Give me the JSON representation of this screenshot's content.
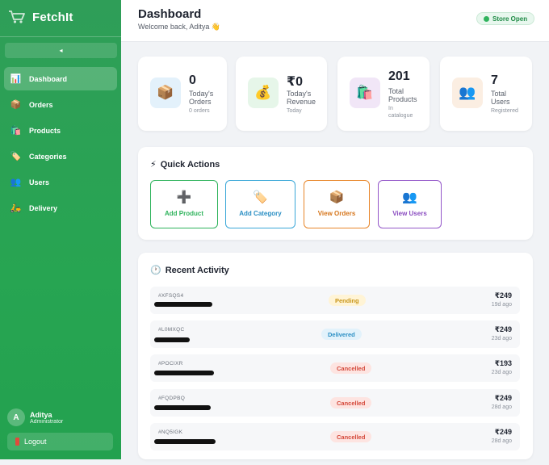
{
  "sidebar": {
    "brand": "FetchIt",
    "collapse_glyph": "◂",
    "items": [
      {
        "label": "Dashboard",
        "icon": "chart-icon",
        "glyph": "📊",
        "active": true
      },
      {
        "label": "Orders",
        "icon": "box-icon",
        "glyph": "📦",
        "active": false
      },
      {
        "label": "Products",
        "icon": "shopping-bags-icon",
        "glyph": "🛍️",
        "active": false
      },
      {
        "label": "Categories",
        "icon": "tag-icon",
        "glyph": "🏷️",
        "active": false
      },
      {
        "label": "Users",
        "icon": "users-icon",
        "glyph": "👥",
        "active": false
      },
      {
        "label": "Delivery",
        "icon": "scooter-icon",
        "glyph": "🛵",
        "active": false
      }
    ],
    "user": {
      "initial": "A",
      "name": "Aditya",
      "role": "Administrator"
    },
    "logout_label": "Logout"
  },
  "header": {
    "title": "Dashboard",
    "subtitle": "Welcome back, Aditya 👋",
    "store_status": "Store Open"
  },
  "stats": [
    {
      "value": "0",
      "label": "Today's Orders",
      "note": "0 orders",
      "icon": "box-icon",
      "glyph": "📦"
    },
    {
      "value": "₹0",
      "label": "Today's Revenue",
      "note": "Today",
      "icon": "money-bag-icon",
      "glyph": "💰"
    },
    {
      "value": "201",
      "label": "Total Products",
      "note": "In catalogue",
      "icon": "shopping-bags-icon",
      "glyph": "🛍️"
    },
    {
      "value": "7",
      "label": "Total Users",
      "note": "Registered",
      "icon": "users-icon",
      "glyph": "👥"
    }
  ],
  "quick_actions": {
    "title": "Quick Actions",
    "title_glyph": "⚡",
    "items": [
      {
        "label": "Add Product",
        "icon": "plus-icon",
        "glyph": "➕",
        "color": "#2fb35c"
      },
      {
        "label": "Add Category",
        "icon": "tag-icon",
        "glyph": "🏷️",
        "color": "#3aa7d8"
      },
      {
        "label": "View Orders",
        "icon": "box-icon",
        "glyph": "📦",
        "color": "#e8862a"
      },
      {
        "label": "View Users",
        "icon": "users-icon",
        "glyph": "👥",
        "color": "#9457c9"
      }
    ]
  },
  "recent_activity": {
    "title": "Recent Activity",
    "title_glyph": "🕐",
    "rows": [
      {
        "order_id": "#XFSQS4",
        "status": "Pending",
        "amount": "₹249",
        "ago": "19d ago"
      },
      {
        "order_id": "#L0MXQC",
        "status": "Delivered",
        "amount": "₹249",
        "ago": "23d ago"
      },
      {
        "order_id": "#POCIXR",
        "status": "Cancelled",
        "amount": "₹193",
        "ago": "23d ago"
      },
      {
        "order_id": "#FQDPBQ",
        "status": "Cancelled",
        "amount": "₹249",
        "ago": "28d ago"
      },
      {
        "order_id": "#NQ5IGK",
        "status": "Cancelled",
        "amount": "₹249",
        "ago": "28d ago"
      }
    ]
  },
  "colors": {
    "sidebar": "#27a552",
    "pending_bg": "#fff4d6",
    "pending_fg": "#c9961a",
    "delivered_bg": "#e2f2fb",
    "delivered_fg": "#2b8fc4",
    "cancelled_bg": "#fde4e1",
    "cancelled_fg": "#d4493b"
  }
}
